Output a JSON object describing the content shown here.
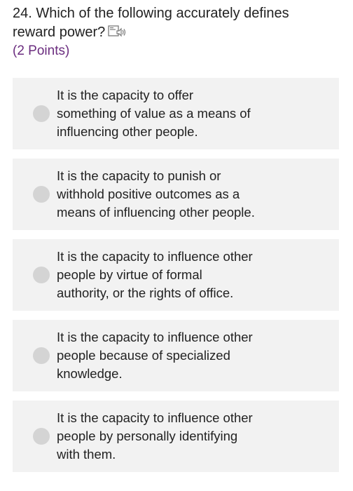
{
  "question": {
    "lines": [
      "24. Which of the following accurately defines",
      "reward power?"
    ],
    "read_aloud_icon": "read-aloud-icon",
    "points": "(2 Points)"
  },
  "options": [
    {
      "lines": [
        "It is the capacity to offer",
        "something of value as a means of",
        "influencing other people."
      ]
    },
    {
      "lines": [
        "It is the capacity to punish or",
        "withhold positive outcomes as a",
        "means of influencing other people."
      ]
    },
    {
      "lines": [
        "It is the capacity to influence other",
        "people by virtue of formal",
        "authority, or the rights of office."
      ]
    },
    {
      "lines": [
        "It is the capacity to influence other",
        "people because of specialized",
        "knowledge."
      ]
    },
    {
      "lines": [
        "It is the capacity to influence other",
        "people by personally identifying",
        "with them."
      ]
    }
  ]
}
